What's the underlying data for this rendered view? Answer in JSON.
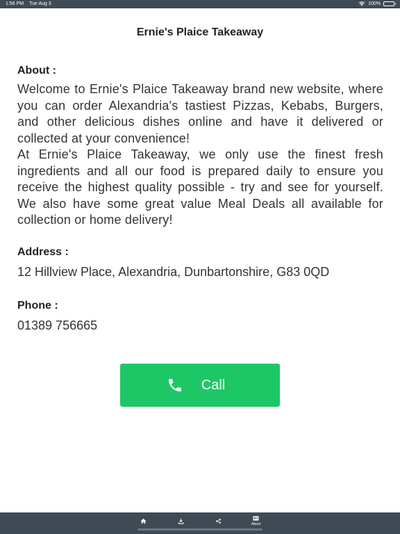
{
  "status_bar": {
    "time": "1:56 PM",
    "date": "Tue Aug 3",
    "battery": "100%",
    "wifi_icon": "wifi-icon",
    "battery_icon": "battery-icon"
  },
  "header": {
    "title": "Ernie's Plaice Takeaway"
  },
  "about": {
    "heading": "About :",
    "paragraphs": [
      "Welcome to Ernie's Plaice Takeaway brand new website, where you can order Alexandria's tastiest Pizzas, Kebabs, Burgers, and other delicious dishes online and have it delivered or collected at your convenience!",
      "At Ernie's Plaice Takeaway, we only use the finest fresh ingredients and all our food is prepared daily to ensure you receive the highest quality possible - try and see for yourself. We also have some great value Meal Deals all available for collection or home delivery!"
    ]
  },
  "address": {
    "heading": "Address :",
    "value": "12 Hillview Place, Alexandria, Dunbartonshire, G83 0QD"
  },
  "phone": {
    "heading": "Phone :",
    "value": "01389 756665"
  },
  "call_button": {
    "label": "Call",
    "icon": "phone-icon",
    "color": "#1dc766"
  },
  "bottom_nav": {
    "items": [
      {
        "icon": "home-icon",
        "label": ""
      },
      {
        "icon": "download-icon",
        "label": ""
      },
      {
        "icon": "share-icon",
        "label": ""
      },
      {
        "icon": "info-card-icon",
        "label": "About"
      }
    ]
  },
  "colors": {
    "bar_background": "#3f4b54",
    "text": "#333333",
    "accent": "#1dc766"
  }
}
